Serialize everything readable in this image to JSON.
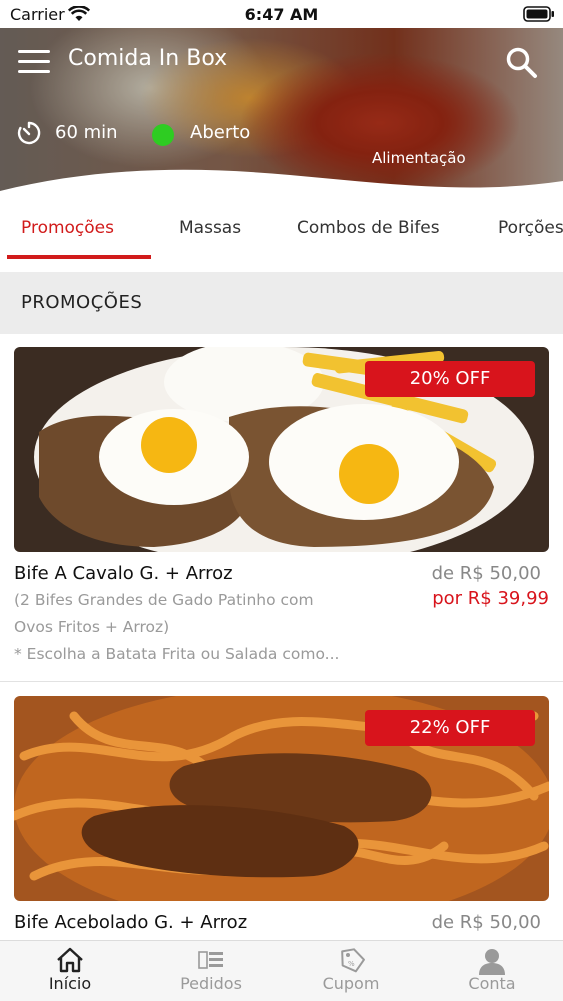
{
  "status_bar": {
    "carrier": "Carrier",
    "time": "6:47 AM"
  },
  "header": {
    "title": "Comida In Box",
    "delivery_time": "60 min",
    "status": "Aberto",
    "status_color": "#2ecc22",
    "category": "Alimentação",
    "icons": [
      "menu-icon",
      "search-icon",
      "timer-icon"
    ]
  },
  "tabs": [
    {
      "label": "Promoções",
      "active": true
    },
    {
      "label": "Massas",
      "active": false
    },
    {
      "label": "Combos de Bifes",
      "active": false
    },
    {
      "label": "Porções",
      "active": false
    }
  ],
  "section": {
    "title": "PROMOÇÕES"
  },
  "items": [
    {
      "name": "Bife A Cavalo G. + Arroz",
      "description_1": "(2 Bifes Grandes de Gado Patinho com",
      "description_2": "Ovos Fritos + Arroz)",
      "description_3": "* Escolha a Batata Frita ou Salada como...",
      "price_old": "de R$ 50,00",
      "price_new": "por R$ 39,99",
      "discount": "20% OFF"
    },
    {
      "name": "Bife Acebolado G. + Arroz",
      "price_old": "de R$ 50,00",
      "discount": "22% OFF"
    }
  ],
  "bottom_nav": [
    {
      "label": "Início",
      "icon": "home-icon",
      "active": true
    },
    {
      "label": "Pedidos",
      "icon": "orders-icon",
      "active": false
    },
    {
      "label": "Cupom",
      "icon": "coupon-icon",
      "active": false
    },
    {
      "label": "Conta",
      "icon": "account-icon",
      "active": false
    }
  ],
  "colors": {
    "accent": "#d11b1b",
    "badge": "#d8141c",
    "section_bg": "#ececec"
  }
}
